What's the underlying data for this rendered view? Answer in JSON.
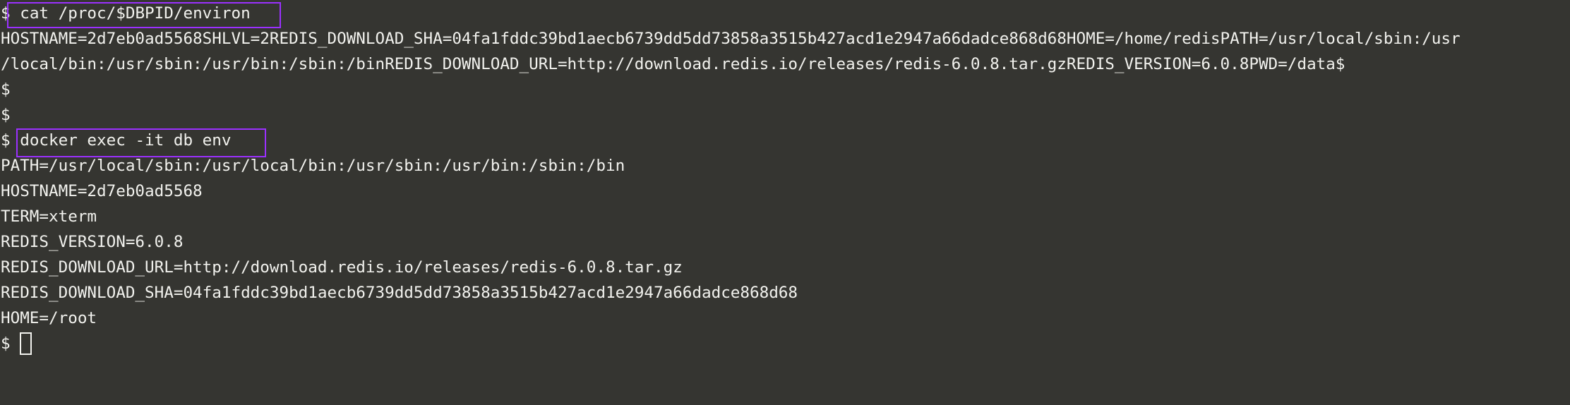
{
  "terminal": {
    "prompt_symbol": "$",
    "lines": [
      {
        "prompt": "$ ",
        "text": "cat /proc/$DBPID/environ"
      },
      {
        "prompt": "",
        "text": "HOSTNAME=2d7eb0ad5568SHLVL=2REDIS_DOWNLOAD_SHA=04fa1fddc39bd1aecb6739dd5dd73858a3515b427acd1e2947a66dadce868d68HOME=/home/redisPATH=/usr/local/sbin:/usr"
      },
      {
        "prompt": "",
        "text": "/local/bin:/usr/sbin:/usr/bin:/sbin:/binREDIS_DOWNLOAD_URL=http://download.redis.io/releases/redis-6.0.8.tar.gzREDIS_VERSION=6.0.8PWD=/data$"
      },
      {
        "prompt": "$",
        "text": ""
      },
      {
        "prompt": "$",
        "text": ""
      },
      {
        "prompt": "$ ",
        "text": "docker exec -it db env"
      },
      {
        "prompt": "",
        "text": "PATH=/usr/local/sbin:/usr/local/bin:/usr/sbin:/usr/bin:/sbin:/bin"
      },
      {
        "prompt": "",
        "text": "HOSTNAME=2d7eb0ad5568"
      },
      {
        "prompt": "",
        "text": "TERM=xterm"
      },
      {
        "prompt": "",
        "text": "REDIS_VERSION=6.0.8"
      },
      {
        "prompt": "",
        "text": "REDIS_DOWNLOAD_URL=http://download.redis.io/releases/redis-6.0.8.tar.gz"
      },
      {
        "prompt": "",
        "text": "REDIS_DOWNLOAD_SHA=04fa1fddc39bd1aecb6739dd5dd73858a3515b427acd1e2947a66dadce868d68"
      },
      {
        "prompt": "",
        "text": "HOME=/root"
      },
      {
        "prompt": "$ ",
        "text": ""
      }
    ]
  },
  "colors": {
    "background": "#353531",
    "foreground": "#f2f2ee",
    "highlight_box": "#9b30ff"
  }
}
